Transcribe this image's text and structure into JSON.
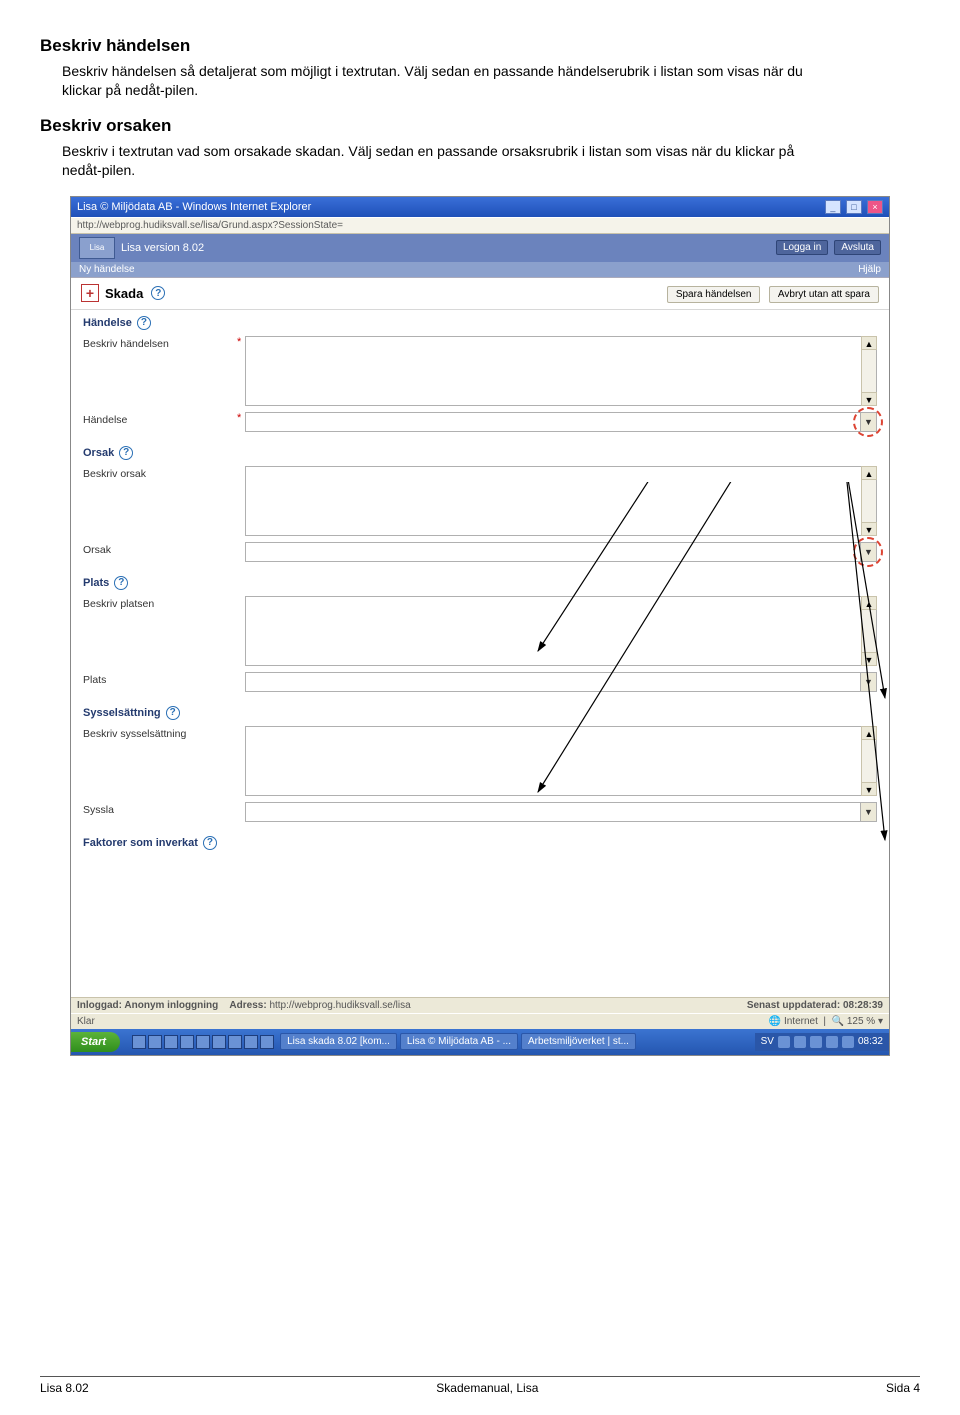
{
  "doc": {
    "h1": "Beskriv händelsen",
    "p1": "Beskriv händelsen så detaljerat som möjligt i textrutan. Välj sedan en passande händelserubrik i listan som visas när du klickar på nedåt-pilen.",
    "h2": "Beskriv orsaken",
    "p2": "Beskriv i textrutan vad som orsakade skadan. Välj sedan en passande orsaksrubrik i listan som visas när du klickar på nedåt-pilen."
  },
  "ie": {
    "title": "Lisa © Miljödata AB - Windows Internet Explorer",
    "url": "http://webprog.hudiksvall.se/lisa/Grund.aspx?SessionState=",
    "status_done": "Klar",
    "status_inet": "Internet",
    "status_zoom": "125 %"
  },
  "lisa": {
    "version": "Lisa version 8.02",
    "login_btn": "Logga in",
    "exit_btn": "Avsluta",
    "menu_new": "Ny händelse",
    "menu_help": "Hjälp",
    "page_title": "Skada",
    "save_btn": "Spara händelsen",
    "cancel_btn": "Avbryt utan att spara",
    "status_logged": "Inloggad: Anonym inloggning",
    "status_addr_lbl": "Adress:",
    "status_addr": "http://webprog.hudiksvall.se/lisa",
    "status_updated": "Senast uppdaterad: 08:28:39"
  },
  "sections": {
    "handelse": {
      "title": "Händelse",
      "f1": "Beskriv händelsen",
      "f2": "Händelse"
    },
    "orsak": {
      "title": "Orsak",
      "f1": "Beskriv orsak",
      "f2": "Orsak"
    },
    "plats": {
      "title": "Plats",
      "f1": "Beskriv platsen",
      "f2": "Plats"
    },
    "syssel": {
      "title": "Sysselsättning",
      "f1": "Beskriv sysselsättning",
      "f2": "Syssla"
    },
    "faktorer": {
      "title": "Faktorer som inverkat"
    }
  },
  "taskbar": {
    "start": "Start",
    "items": [
      "Lisa skada 8.02 [kom...",
      "Lisa © Miljödata AB - ...",
      "Arbetsmiljöverket | st..."
    ],
    "lang": "SV",
    "clock": "08:32"
  },
  "footer": {
    "left": "Lisa 8.02",
    "center": "Skademanual, Lisa",
    "right": "Sida 4"
  }
}
